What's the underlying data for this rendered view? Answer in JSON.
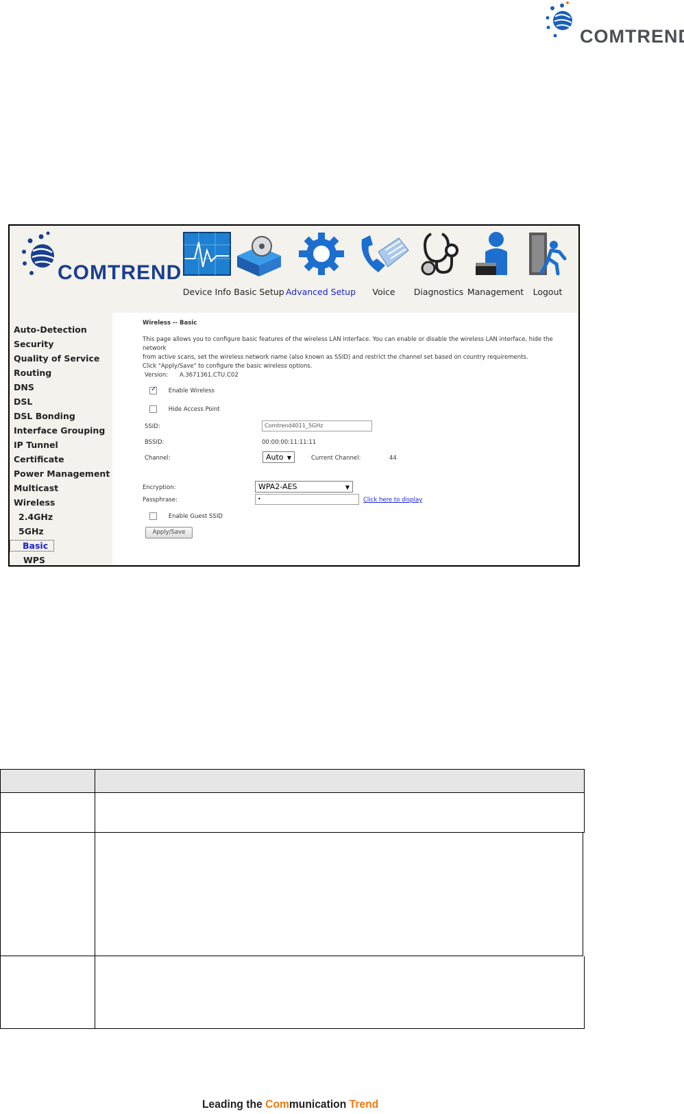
{
  "page_logo": {
    "text": "COMTREND"
  },
  "frame": {
    "logo_text": "COMTREND",
    "nav": [
      {
        "label": "Device Info",
        "icon": "device-info-monitor-icon",
        "active": false
      },
      {
        "label": "Basic Setup",
        "icon": "basic-setup-box-icon",
        "active": false
      },
      {
        "label": "Advanced Setup",
        "icon": "advanced-setup-gear-icon",
        "active": true
      },
      {
        "label": "Voice",
        "icon": "voice-phone-icon",
        "active": false
      },
      {
        "label": "Diagnostics",
        "icon": "diagnostics-stethoscope-icon",
        "active": false
      },
      {
        "label": "Management",
        "icon": "management-person-icon",
        "active": false
      },
      {
        "label": "Logout",
        "icon": "logout-exit-icon",
        "active": false
      }
    ],
    "sidebar": [
      "Auto-Detection",
      "Security",
      "Quality of Service",
      "Routing",
      "DNS",
      "DSL",
      "DSL Bonding",
      "Interface Grouping",
      "IP Tunnel",
      "Certificate",
      "Power Management",
      "Multicast",
      "Wireless",
      "2.4GHz",
      "5GHz",
      "Basic",
      "WPS"
    ],
    "content": {
      "title": "Wireless -- Basic",
      "description_line1": "This page allows you to configure basic features of the wireless LAN interface. You can enable or disable the wireless LAN interface, hide the network",
      "description_line2": "from active scans, set the wireless network name (also known as SSID) and restrict the channel set based on country requirements.",
      "description_line3": "Click \"Apply/Save\" to configure the basic wireless options.",
      "version_label": "Version:",
      "version_value": "A.3671361.CTU.C02",
      "enable_wireless_label": "Enable Wireless",
      "enable_wireless_checked": true,
      "hide_ap_label": "Hide Access Point",
      "hide_ap_checked": false,
      "ssid_label": "SSID:",
      "ssid_value": "Comtrend4011_5GHz",
      "bssid_label": "BSSID:",
      "bssid_value": "00:00:00:11:11:11",
      "channel_label": "Channel:",
      "channel_value": "Auto",
      "current_channel_label": "Current Channel:",
      "current_channel_value": "44",
      "encryption_label": "Encryption:",
      "encryption_value": "WPA2-AES",
      "passphrase_label": "Passphrase:",
      "passphrase_value": "•",
      "passphrase_link": "Click here to display",
      "guest_ssid_label": "Enable Guest SSID",
      "guest_ssid_checked": false,
      "apply_button": "Apply/Save"
    }
  },
  "footer": {
    "part1": "Leading the ",
    "part2": "Com",
    "part3": "munication ",
    "part4": "Trend"
  },
  "colors": {
    "brand_blue": "#1b3f8f",
    "active_nav": "#1a25c9",
    "footer_orange": "#f07a13"
  }
}
